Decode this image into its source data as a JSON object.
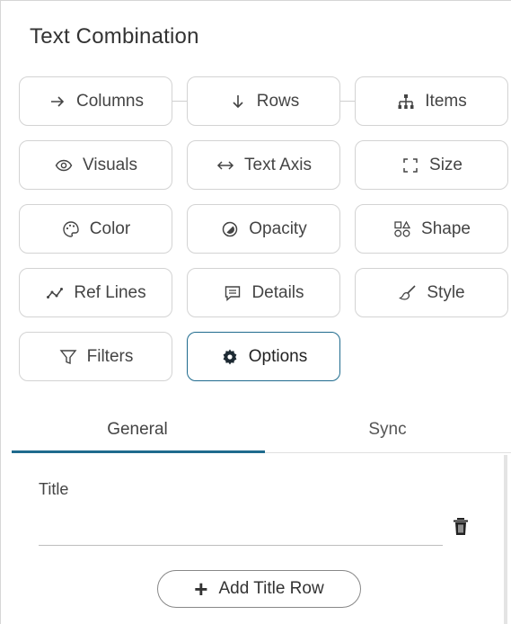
{
  "panel": {
    "title": "Text Combination"
  },
  "buttons": {
    "columns": "Columns",
    "rows": "Rows",
    "items": "Items",
    "visuals": "Visuals",
    "text_axis": "Text Axis",
    "size": "Size",
    "color": "Color",
    "opacity": "Opacity",
    "shape": "Shape",
    "ref_lines": "Ref Lines",
    "details": "Details",
    "style": "Style",
    "filters": "Filters",
    "options": "Options"
  },
  "active_button": "options",
  "tabs": [
    {
      "label": "General",
      "active": true
    },
    {
      "label": "Sync",
      "active": false
    }
  ],
  "general": {
    "title_label": "Title",
    "title_value": "",
    "add_title_row_label": "Add Title Row"
  },
  "colors": {
    "accent": "#1f6b8e",
    "border": "#d3d3d3",
    "text": "#444444"
  }
}
